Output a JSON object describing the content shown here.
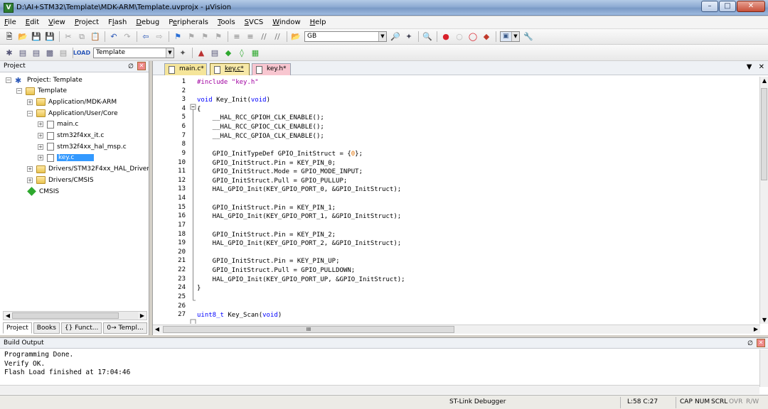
{
  "window": {
    "title": "D:\\AI+STM32\\Template\\MDK-ARM\\Template.uvprojx - µVision",
    "app_icon_glyph": "V"
  },
  "menu": [
    "File",
    "Edit",
    "View",
    "Project",
    "Flash",
    "Debug",
    "Peripherals",
    "Tools",
    "SVCS",
    "Window",
    "Help"
  ],
  "menu_underline_index": [
    0,
    0,
    0,
    0,
    1,
    0,
    1,
    0,
    0,
    0,
    0
  ],
  "toolbar": {
    "find_combo_value": "GB",
    "target_combo_value": "Template"
  },
  "project_panel": {
    "title": "Project",
    "tree": [
      {
        "label": "Project: Template",
        "depth": 0,
        "expander": "minus",
        "icon": "project-icon"
      },
      {
        "label": "Template",
        "depth": 1,
        "expander": "minus",
        "icon": "folder-icon"
      },
      {
        "label": "Application/MDK-ARM",
        "depth": 2,
        "expander": "plus",
        "icon": "folder-icon"
      },
      {
        "label": "Application/User/Core",
        "depth": 2,
        "expander": "minus",
        "icon": "folder-icon"
      },
      {
        "label": "main.c",
        "depth": 3,
        "expander": "plus",
        "icon": "file-icon"
      },
      {
        "label": "stm32f4xx_it.c",
        "depth": 3,
        "expander": "plus",
        "icon": "file-icon"
      },
      {
        "label": "stm32f4xx_hal_msp.c",
        "depth": 3,
        "expander": "plus",
        "icon": "file-icon"
      },
      {
        "label": "key.c",
        "depth": 3,
        "expander": "plus",
        "icon": "file-icon",
        "selected": true
      },
      {
        "label": "Drivers/STM32F4xx_HAL_Driver",
        "depth": 2,
        "expander": "plus",
        "icon": "folder-icon"
      },
      {
        "label": "Drivers/CMSIS",
        "depth": 2,
        "expander": "plus",
        "icon": "folder-icon"
      },
      {
        "label": "CMSIS",
        "depth": 2,
        "expander": "none",
        "icon": "cmsis-diamond-icon"
      }
    ],
    "tabs": [
      "Project",
      "Books",
      "{} Funct...",
      "0→ Templ..."
    ]
  },
  "editor": {
    "tabs": [
      {
        "label": "main.c*",
        "active": false
      },
      {
        "label": "key.c*",
        "active": true
      },
      {
        "label": "key.h*",
        "active": false
      }
    ],
    "lines": [
      {
        "n": "1",
        "text": "#include \"key.h\""
      },
      {
        "n": "2",
        "text": ""
      },
      {
        "n": "3",
        "text": "void Key_Init(void)"
      },
      {
        "n": "4",
        "text": "{"
      },
      {
        "n": "5",
        "text": "    __HAL_RCC_GPIOH_CLK_ENABLE();"
      },
      {
        "n": "6",
        "text": "    __HAL_RCC_GPIOC_CLK_ENABLE();"
      },
      {
        "n": "7",
        "text": "    __HAL_RCC_GPIOA_CLK_ENABLE();"
      },
      {
        "n": "8",
        "text": ""
      },
      {
        "n": "9",
        "text": "    GPIO_InitTypeDef GPIO_InitStruct = {0};"
      },
      {
        "n": "10",
        "text": "    GPIO_InitStruct.Pin = KEY_PIN_0;"
      },
      {
        "n": "11",
        "text": "    GPIO_InitStruct.Mode = GPIO_MODE_INPUT;"
      },
      {
        "n": "12",
        "text": "    GPIO_InitStruct.Pull = GPIO_PULLUP;"
      },
      {
        "n": "13",
        "text": "    HAL_GPIO_Init(KEY_GPIO_PORT_0, &GPIO_InitStruct);"
      },
      {
        "n": "14",
        "text": ""
      },
      {
        "n": "15",
        "text": "    GPIO_InitStruct.Pin = KEY_PIN_1;"
      },
      {
        "n": "16",
        "text": "    HAL_GPIO_Init(KEY_GPIO_PORT_1, &GPIO_InitStruct);"
      },
      {
        "n": "17",
        "text": ""
      },
      {
        "n": "18",
        "text": "    GPIO_InitStruct.Pin = KEY_PIN_2;"
      },
      {
        "n": "19",
        "text": "    HAL_GPIO_Init(KEY_GPIO_PORT_2, &GPIO_InitStruct);"
      },
      {
        "n": "20",
        "text": ""
      },
      {
        "n": "21",
        "text": "    GPIO_InitStruct.Pin = KEY_PIN_UP;"
      },
      {
        "n": "22",
        "text": "    GPIO_InitStruct.Pull = GPIO_PULLDOWN;"
      },
      {
        "n": "23",
        "text": "    HAL_GPIO_Init(KEY_GPIO_PORT_UP, &GPIO_InitStruct);"
      },
      {
        "n": "24",
        "text": "}"
      },
      {
        "n": "25",
        "text": ""
      },
      {
        "n": "26",
        "text": ""
      },
      {
        "n": "27",
        "text": "uint8_t Key_Scan(void)"
      }
    ],
    "hscroll_thumb_label": "III"
  },
  "build_output": {
    "title": "Build Output",
    "lines": [
      "Programming Done.",
      "Verify OK.",
      "Flash Load finished at 17:04:46"
    ]
  },
  "statusbar": {
    "debugger": "ST-Link Debugger",
    "position": "L:58 C:27",
    "caps": "CAP",
    "num": "NUM",
    "scrl": "SCRL",
    "ovr": "OVR",
    "rw": "R/W"
  },
  "colors": {
    "keyword": "#0000ff",
    "preprocessor": "#a000a0",
    "number": "#e07000",
    "selection": "#3399ff"
  }
}
